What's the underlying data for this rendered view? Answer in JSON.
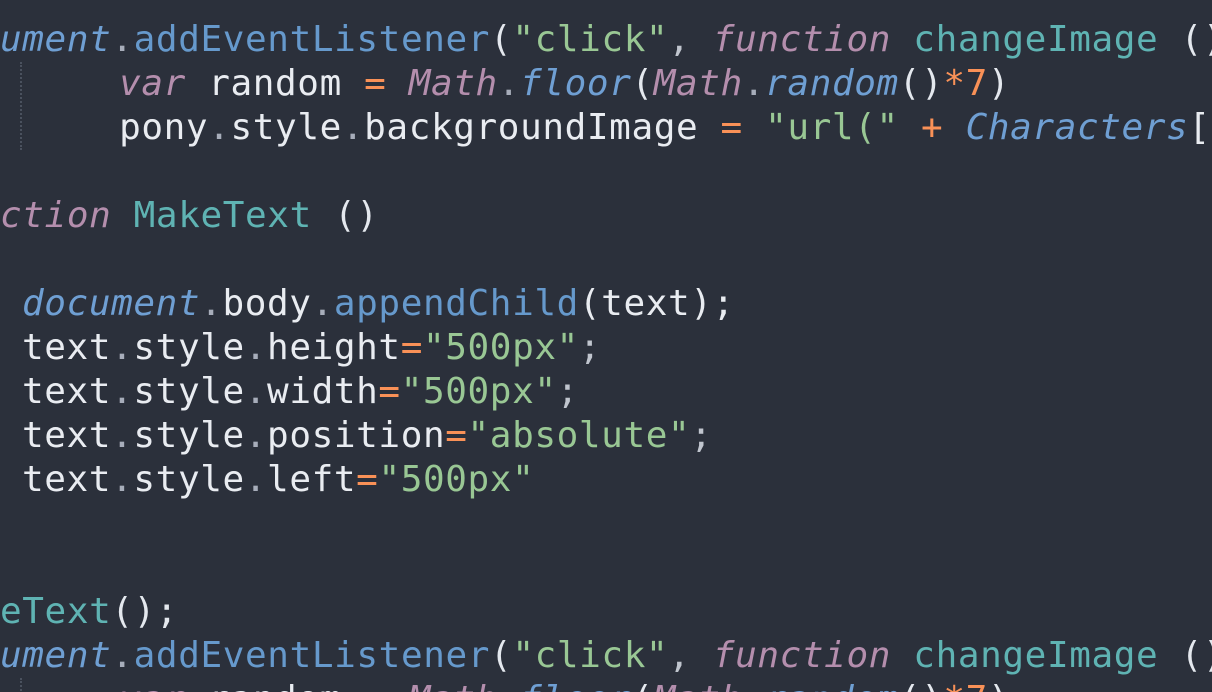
{
  "editor": {
    "theme_colors": {
      "background": "#2b303b",
      "text": "#c0c5ce",
      "keyword": "#b48ead",
      "function": "#5fb3b3",
      "method": "#6699cc",
      "string": "#99c794",
      "operator": "#f99157"
    },
    "lines": [
      {
        "tokens": [
          {
            "t": "ument",
            "c": "t-ital-blue"
          },
          {
            "t": ".",
            "c": "t-dot"
          },
          {
            "t": "addEventListener",
            "c": "t-method"
          },
          {
            "t": "(",
            "c": "t-paren"
          },
          {
            "t": "\"click\"",
            "c": "t-str"
          },
          {
            "t": ", ",
            "c": "t-punc"
          },
          {
            "t": "function",
            "c": "t-key"
          },
          {
            "t": " ",
            "c": "t-punc"
          },
          {
            "t": "changeImage",
            "c": "t-func"
          },
          {
            "t": " (){",
            "c": "t-paren"
          }
        ]
      },
      {
        "tokens": [
          {
            "t": "    ",
            "c": "t-punc"
          },
          {
            "t": "var",
            "c": "t-key"
          },
          {
            "t": " random ",
            "c": "t-plain"
          },
          {
            "t": "=",
            "c": "t-op"
          },
          {
            "t": " ",
            "c": "t-punc"
          },
          {
            "t": "Math",
            "c": "t-key"
          },
          {
            "t": ".",
            "c": "t-dot"
          },
          {
            "t": "floor",
            "c": "t-ital-blue"
          },
          {
            "t": "(",
            "c": "t-paren"
          },
          {
            "t": "Math",
            "c": "t-key"
          },
          {
            "t": ".",
            "c": "t-dot"
          },
          {
            "t": "random",
            "c": "t-ital-blue"
          },
          {
            "t": "()",
            "c": "t-paren"
          },
          {
            "t": "*",
            "c": "t-op"
          },
          {
            "t": "7",
            "c": "t-num"
          },
          {
            "t": ")",
            "c": "t-paren"
          }
        ]
      },
      {
        "tokens": [
          {
            "t": "    ",
            "c": "t-punc"
          },
          {
            "t": "pony",
            "c": "t-plain"
          },
          {
            "t": ".",
            "c": "t-dot"
          },
          {
            "t": "style",
            "c": "t-plain"
          },
          {
            "t": ".",
            "c": "t-dot"
          },
          {
            "t": "backgroundImage ",
            "c": "t-plain"
          },
          {
            "t": "=",
            "c": "t-op"
          },
          {
            "t": " ",
            "c": "t-punc"
          },
          {
            "t": "\"url(\"",
            "c": "t-str"
          },
          {
            "t": " ",
            "c": "t-punc"
          },
          {
            "t": "+",
            "c": "t-op"
          },
          {
            "t": " ",
            "c": "t-punc"
          },
          {
            "t": "Characters",
            "c": "t-ital-blue"
          },
          {
            "t": "[ra",
            "c": "t-plain"
          }
        ]
      },
      {
        "tokens": []
      },
      {
        "tokens": [
          {
            "t": "ction",
            "c": "t-key"
          },
          {
            "t": " ",
            "c": "t-punc"
          },
          {
            "t": "MakeText",
            "c": "t-func"
          },
          {
            "t": " ()",
            "c": "t-paren"
          }
        ]
      },
      {
        "tokens": []
      },
      {
        "tokens": [
          {
            "t": "document",
            "c": "t-ital-blue"
          },
          {
            "t": ".",
            "c": "t-dot"
          },
          {
            "t": "body",
            "c": "t-plain"
          },
          {
            "t": ".",
            "c": "t-dot"
          },
          {
            "t": "appendChild",
            "c": "t-method"
          },
          {
            "t": "(text);",
            "c": "t-plain"
          }
        ]
      },
      {
        "tokens": [
          {
            "t": "text",
            "c": "t-plain"
          },
          {
            "t": ".",
            "c": "t-dot"
          },
          {
            "t": "style",
            "c": "t-plain"
          },
          {
            "t": ".",
            "c": "t-dot"
          },
          {
            "t": "height",
            "c": "t-plain"
          },
          {
            "t": "=",
            "c": "t-op"
          },
          {
            "t": "\"500px\"",
            "c": "t-str"
          },
          {
            "t": ";",
            "c": "t-punc"
          }
        ]
      },
      {
        "tokens": [
          {
            "t": "text",
            "c": "t-plain"
          },
          {
            "t": ".",
            "c": "t-dot"
          },
          {
            "t": "style",
            "c": "t-plain"
          },
          {
            "t": ".",
            "c": "t-dot"
          },
          {
            "t": "width",
            "c": "t-plain"
          },
          {
            "t": "=",
            "c": "t-op"
          },
          {
            "t": "\"500px\"",
            "c": "t-str"
          },
          {
            "t": ";",
            "c": "t-punc"
          }
        ]
      },
      {
        "tokens": [
          {
            "t": "text",
            "c": "t-plain"
          },
          {
            "t": ".",
            "c": "t-dot"
          },
          {
            "t": "style",
            "c": "t-plain"
          },
          {
            "t": ".",
            "c": "t-dot"
          },
          {
            "t": "position",
            "c": "t-plain"
          },
          {
            "t": "=",
            "c": "t-op"
          },
          {
            "t": "\"absolute\"",
            "c": "t-str"
          },
          {
            "t": ";",
            "c": "t-punc"
          }
        ]
      },
      {
        "tokens": [
          {
            "t": "text",
            "c": "t-plain"
          },
          {
            "t": ".",
            "c": "t-dot"
          },
          {
            "t": "style",
            "c": "t-plain"
          },
          {
            "t": ".",
            "c": "t-dot"
          },
          {
            "t": "left",
            "c": "t-plain"
          },
          {
            "t": "=",
            "c": "t-op"
          },
          {
            "t": "\"500px\"",
            "c": "t-str"
          }
        ]
      },
      {
        "tokens": []
      },
      {
        "tokens": []
      },
      {
        "tokens": [
          {
            "t": "eText",
            "c": "t-func"
          },
          {
            "t": "();",
            "c": "t-paren"
          }
        ]
      },
      {
        "tokens": [
          {
            "t": "ument",
            "c": "t-ital-blue"
          },
          {
            "t": ".",
            "c": "t-dot"
          },
          {
            "t": "addEventListener",
            "c": "t-method"
          },
          {
            "t": "(",
            "c": "t-paren"
          },
          {
            "t": "\"click\"",
            "c": "t-str"
          },
          {
            "t": ", ",
            "c": "t-punc"
          },
          {
            "t": "function",
            "c": "t-key"
          },
          {
            "t": " ",
            "c": "t-punc"
          },
          {
            "t": "changeImage",
            "c": "t-func"
          },
          {
            "t": " (){",
            "c": "t-paren"
          }
        ]
      },
      {
        "tokens": [
          {
            "t": "    ",
            "c": "t-punc"
          },
          {
            "t": "var",
            "c": "t-key"
          },
          {
            "t": " random ",
            "c": "t-plain"
          },
          {
            "t": "=",
            "c": "t-op"
          },
          {
            "t": " ",
            "c": "t-punc"
          },
          {
            "t": "Math",
            "c": "t-key"
          },
          {
            "t": ".",
            "c": "t-dot"
          },
          {
            "t": "floor",
            "c": "t-ital-blue"
          },
          {
            "t": "(",
            "c": "t-paren"
          },
          {
            "t": "Math",
            "c": "t-key"
          },
          {
            "t": ".",
            "c": "t-dot"
          },
          {
            "t": "random",
            "c": "t-ital-blue"
          },
          {
            "t": "()",
            "c": "t-paren"
          },
          {
            "t": "*",
            "c": "t-op"
          },
          {
            "t": "7",
            "c": "t-num"
          },
          {
            "t": ")",
            "c": "t-paren"
          }
        ]
      }
    ]
  }
}
